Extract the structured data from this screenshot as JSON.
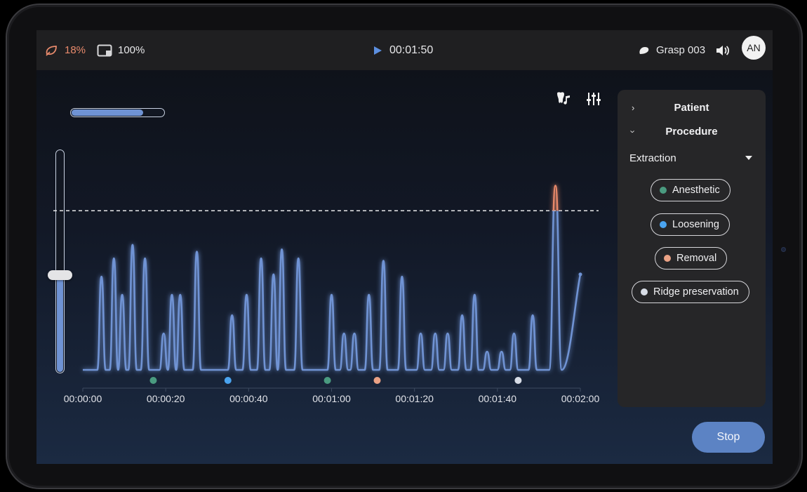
{
  "topbar": {
    "battery_icon": "leaf-icon",
    "battery_percent": "18%",
    "screen_icon": "screen-icon",
    "screen_percent": "100%",
    "play_icon": "play-icon",
    "elapsed_time": "00:01:50",
    "device_icon": "tooth-icon",
    "device_name": "Grasp 003",
    "volume_icon": "volume-icon",
    "avatar_initials": "AN"
  },
  "controls": {
    "progress_fraction": 0.78,
    "level_fraction": 0.44,
    "tool_icons": [
      "tooth-music-icon",
      "sliders-icon"
    ]
  },
  "chart_data": {
    "type": "line",
    "x_ticks": [
      "00:00:00",
      "00:00:20",
      "00:00:40",
      "00:01:00",
      "00:01:20",
      "00:01:40",
      "00:02:00"
    ],
    "x_range_seconds": [
      0,
      120
    ],
    "y_range": [
      0,
      1
    ],
    "threshold": 0.7,
    "line_color": "#6f93d4",
    "over_threshold_color": "#e8896a",
    "markers": [
      {
        "t": 17,
        "color": "#4a9b80"
      },
      {
        "t": 35,
        "color": "#4aa4f0"
      },
      {
        "t": 59,
        "color": "#4a9b80"
      },
      {
        "t": 71,
        "color": "#eba285"
      },
      {
        "t": 105,
        "color": "#d8dde6"
      }
    ],
    "peaks": [
      [
        4.5,
        0.41
      ],
      [
        7.5,
        0.49
      ],
      [
        9.5,
        0.33
      ],
      [
        12,
        0.55
      ],
      [
        15,
        0.49
      ],
      [
        19.5,
        0.16
      ],
      [
        21.5,
        0.33
      ],
      [
        23.5,
        0.33
      ],
      [
        27.5,
        0.52
      ],
      [
        36,
        0.24
      ],
      [
        39.5,
        0.33
      ],
      [
        43,
        0.49
      ],
      [
        46,
        0.42
      ],
      [
        48,
        0.53
      ],
      [
        52,
        0.49
      ],
      [
        60,
        0.33
      ],
      [
        63,
        0.16
      ],
      [
        65.5,
        0.16
      ],
      [
        69,
        0.33
      ],
      [
        72.5,
        0.48
      ],
      [
        77,
        0.41
      ],
      [
        81.5,
        0.16
      ],
      [
        85,
        0.16
      ],
      [
        88,
        0.16
      ],
      [
        91.5,
        0.24
      ],
      [
        94.5,
        0.33
      ],
      [
        97.5,
        0.08
      ],
      [
        101,
        0.08
      ],
      [
        104,
        0.16
      ],
      [
        108.5,
        0.24
      ],
      [
        114,
        0.81
      ]
    ],
    "end_point": [
      120,
      0.42
    ]
  },
  "panel": {
    "patient_label": "Patient",
    "procedure_label": "Procedure",
    "select_value": "Extraction",
    "chips": [
      {
        "label": "Anesthetic",
        "color": "#4a9b80"
      },
      {
        "label": "Loosening",
        "color": "#4aa4f0"
      },
      {
        "label": "Removal",
        "color": "#eba285"
      },
      {
        "label": "Ridge preservation",
        "color": "#d8dde6"
      }
    ]
  },
  "stop_label": "Stop"
}
